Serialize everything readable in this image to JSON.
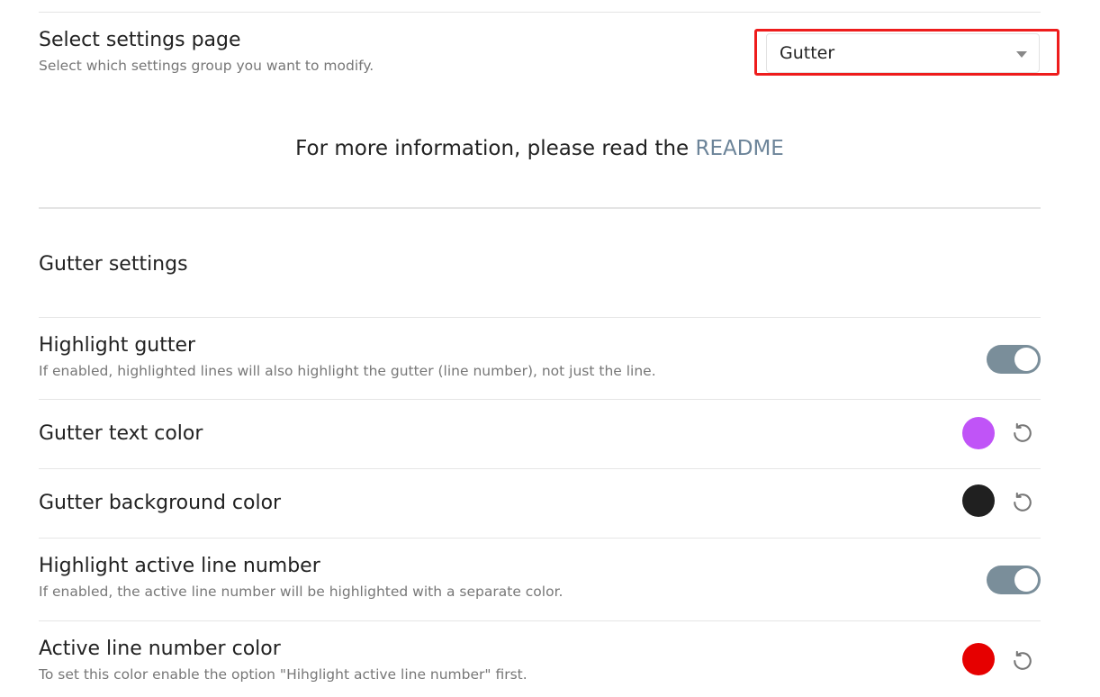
{
  "select_page": {
    "title": "Select settings page",
    "description": "Select which settings group you want to modify.",
    "selected": "Gutter"
  },
  "info": {
    "text": "For more information, please read the ",
    "link": "README"
  },
  "section": {
    "title": "Gutter settings"
  },
  "settings": [
    {
      "name": "Highlight gutter",
      "description": "If enabled, highlighted lines will also highlight the gutter (line number), not just the line.",
      "control": "toggle",
      "enabled": true
    },
    {
      "name": "Gutter text color",
      "control": "color",
      "color": "#c054f7"
    },
    {
      "name": "Gutter background color",
      "control": "color",
      "color": "#202020"
    },
    {
      "name": "Highlight active line number",
      "description": "If enabled, the active line number will be highlighted with a separate color.",
      "control": "toggle",
      "enabled": true
    },
    {
      "name": "Active line number color",
      "description": "To set this color enable the option \"Hihglight active line number\" first.",
      "control": "color",
      "color": "#e60000"
    }
  ],
  "colors": {
    "highlight_box": "#ee1c1c",
    "toggle_on": "#7a8e9a",
    "link": "#6c8499"
  },
  "icons": {
    "reset": "reset-icon",
    "dropdown": "chevron-down-icon"
  }
}
